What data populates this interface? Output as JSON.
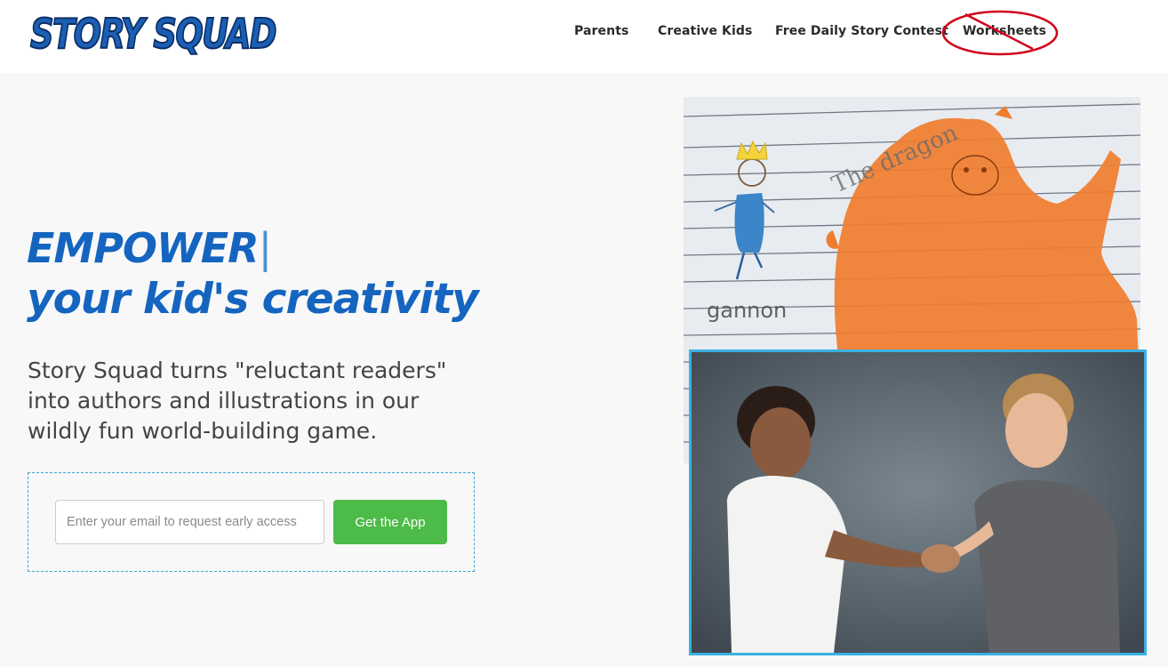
{
  "header": {
    "logo_text": "STORY SQUAD",
    "nav": [
      {
        "label": "Parents"
      },
      {
        "label": "Creative Kids"
      },
      {
        "label": "Free Daily Story Contest"
      },
      {
        "label": "Worksheets"
      }
    ]
  },
  "hero": {
    "title_line1": "EMPOWER",
    "title_cursor": "|",
    "title_line2": "your kid's creativity",
    "description": "Story Squad turns \"reluctant readers\" into authors and illustrations in our wildly fun world-building game."
  },
  "signup": {
    "email_placeholder": "Enter your email to request early access",
    "email_value": "",
    "button_label": "Get the App"
  },
  "images": {
    "drawing_caption": "The dragon",
    "drawing_signature": "gannon"
  },
  "colors": {
    "brand_blue": "#1565c0",
    "button_green": "#4cbb47",
    "box_border": "#3aa6d6",
    "annotation_red": "#d0021b"
  }
}
